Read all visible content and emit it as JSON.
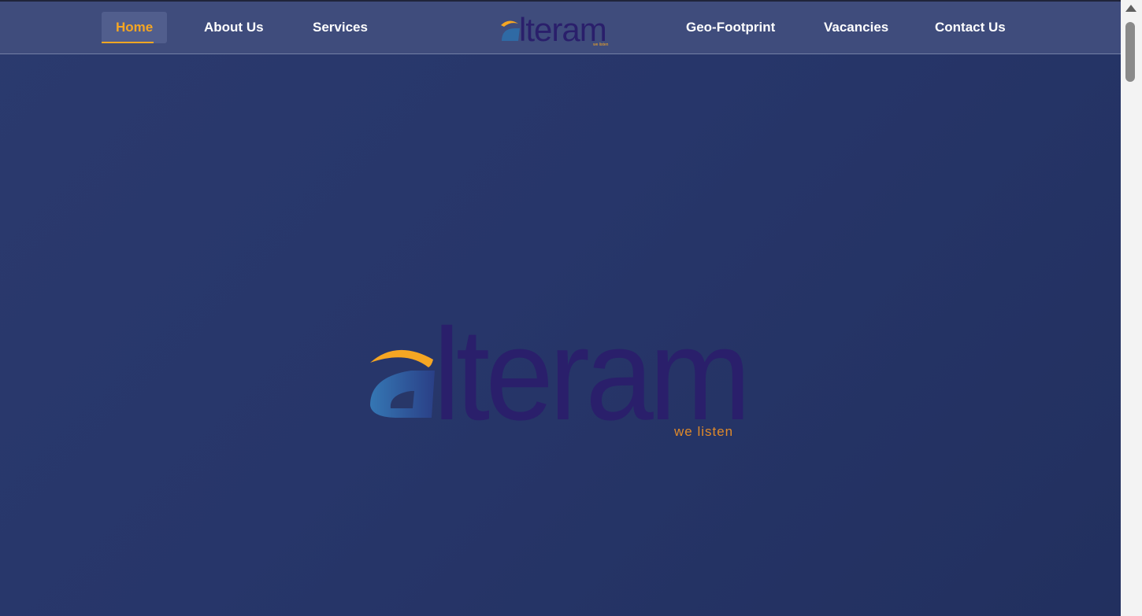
{
  "nav": {
    "items": [
      {
        "label": "Home",
        "active": true
      },
      {
        "label": "About Us"
      },
      {
        "label": "Services"
      },
      {
        "label": "Geo-Footprint"
      },
      {
        "label": "Vacancies"
      },
      {
        "label": "Contact Us"
      }
    ],
    "logo": {
      "wordmark": "lteram",
      "tagline": "we listen"
    }
  },
  "hero": {
    "logo": {
      "wordmark": "lteram",
      "tagline": "we listen"
    }
  },
  "colors": {
    "accent": "#f5a623",
    "navbar": "#3f4c7c",
    "background": "#283768",
    "logo_text": "#2a1f6b",
    "logo_swoosh": "#f5a623",
    "logo_a": "#2f6aa5"
  },
  "icons": {
    "scroll_up": "scroll-up-arrow-icon"
  }
}
